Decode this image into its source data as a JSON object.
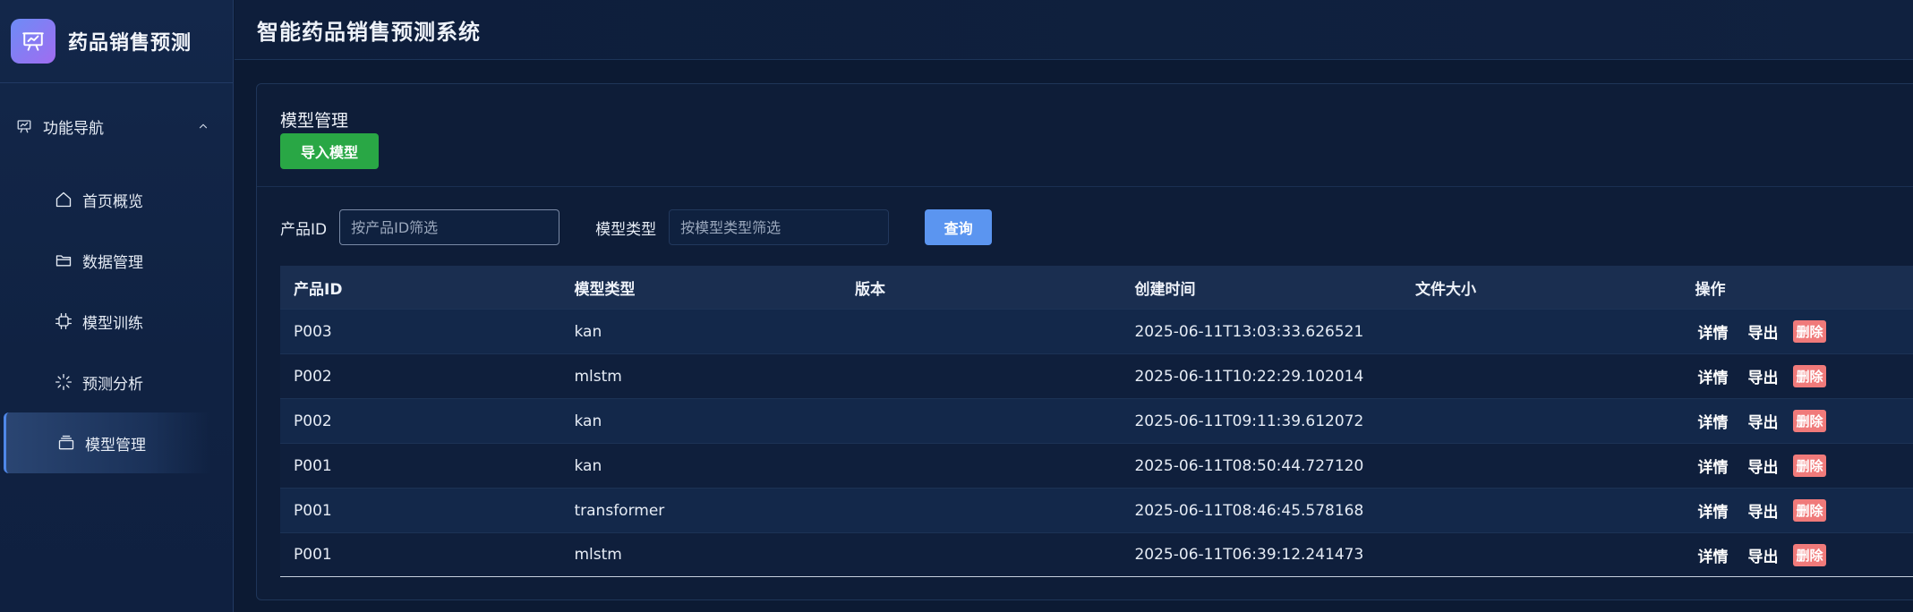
{
  "brand": {
    "title": "药品销售预测",
    "logo_icon": "presentation-board-icon"
  },
  "header": {
    "title": "智能药品销售预测系统"
  },
  "nav": {
    "group_label": "功能导航",
    "items": [
      {
        "label": "首页概览",
        "icon": "home-icon"
      },
      {
        "label": "数据管理",
        "icon": "folder-icon"
      },
      {
        "label": "模型训练",
        "icon": "cpu-icon"
      },
      {
        "label": "预测分析",
        "icon": "loading-icon"
      },
      {
        "label": "模型管理",
        "icon": "stack-icon",
        "active": true
      }
    ]
  },
  "card": {
    "title": "模型管理",
    "import_label": "导入模型"
  },
  "filters": {
    "product_label": "产品ID",
    "product_placeholder": "按产品ID筛选",
    "type_label": "模型类型",
    "type_placeholder": "按模型类型筛选",
    "query_label": "查询"
  },
  "table": {
    "headers": [
      "产品ID",
      "模型类型",
      "版本",
      "创建时间",
      "文件大小",
      "操作"
    ],
    "rows": [
      {
        "product": "P003",
        "type": "kan",
        "version": "",
        "created": "2025-06-11T13:03:33.626521",
        "size": ""
      },
      {
        "product": "P002",
        "type": "mlstm",
        "version": "",
        "created": "2025-06-11T10:22:29.102014",
        "size": ""
      },
      {
        "product": "P002",
        "type": "kan",
        "version": "",
        "created": "2025-06-11T09:11:39.612072",
        "size": ""
      },
      {
        "product": "P001",
        "type": "kan",
        "version": "",
        "created": "2025-06-11T08:50:44.727120",
        "size": ""
      },
      {
        "product": "P001",
        "type": "transformer",
        "version": "",
        "created": "2025-06-11T08:46:45.578168",
        "size": ""
      },
      {
        "product": "P001",
        "type": "mlstm",
        "version": "",
        "created": "2025-06-11T06:39:12.241473",
        "size": ""
      }
    ],
    "actions": {
      "detail": "详情",
      "export": "导出",
      "delete": "删除"
    }
  },
  "colors": {
    "accent": "#5b95f0",
    "success": "#29a745",
    "danger": "#f07a7a",
    "background": "#0c1a33"
  }
}
